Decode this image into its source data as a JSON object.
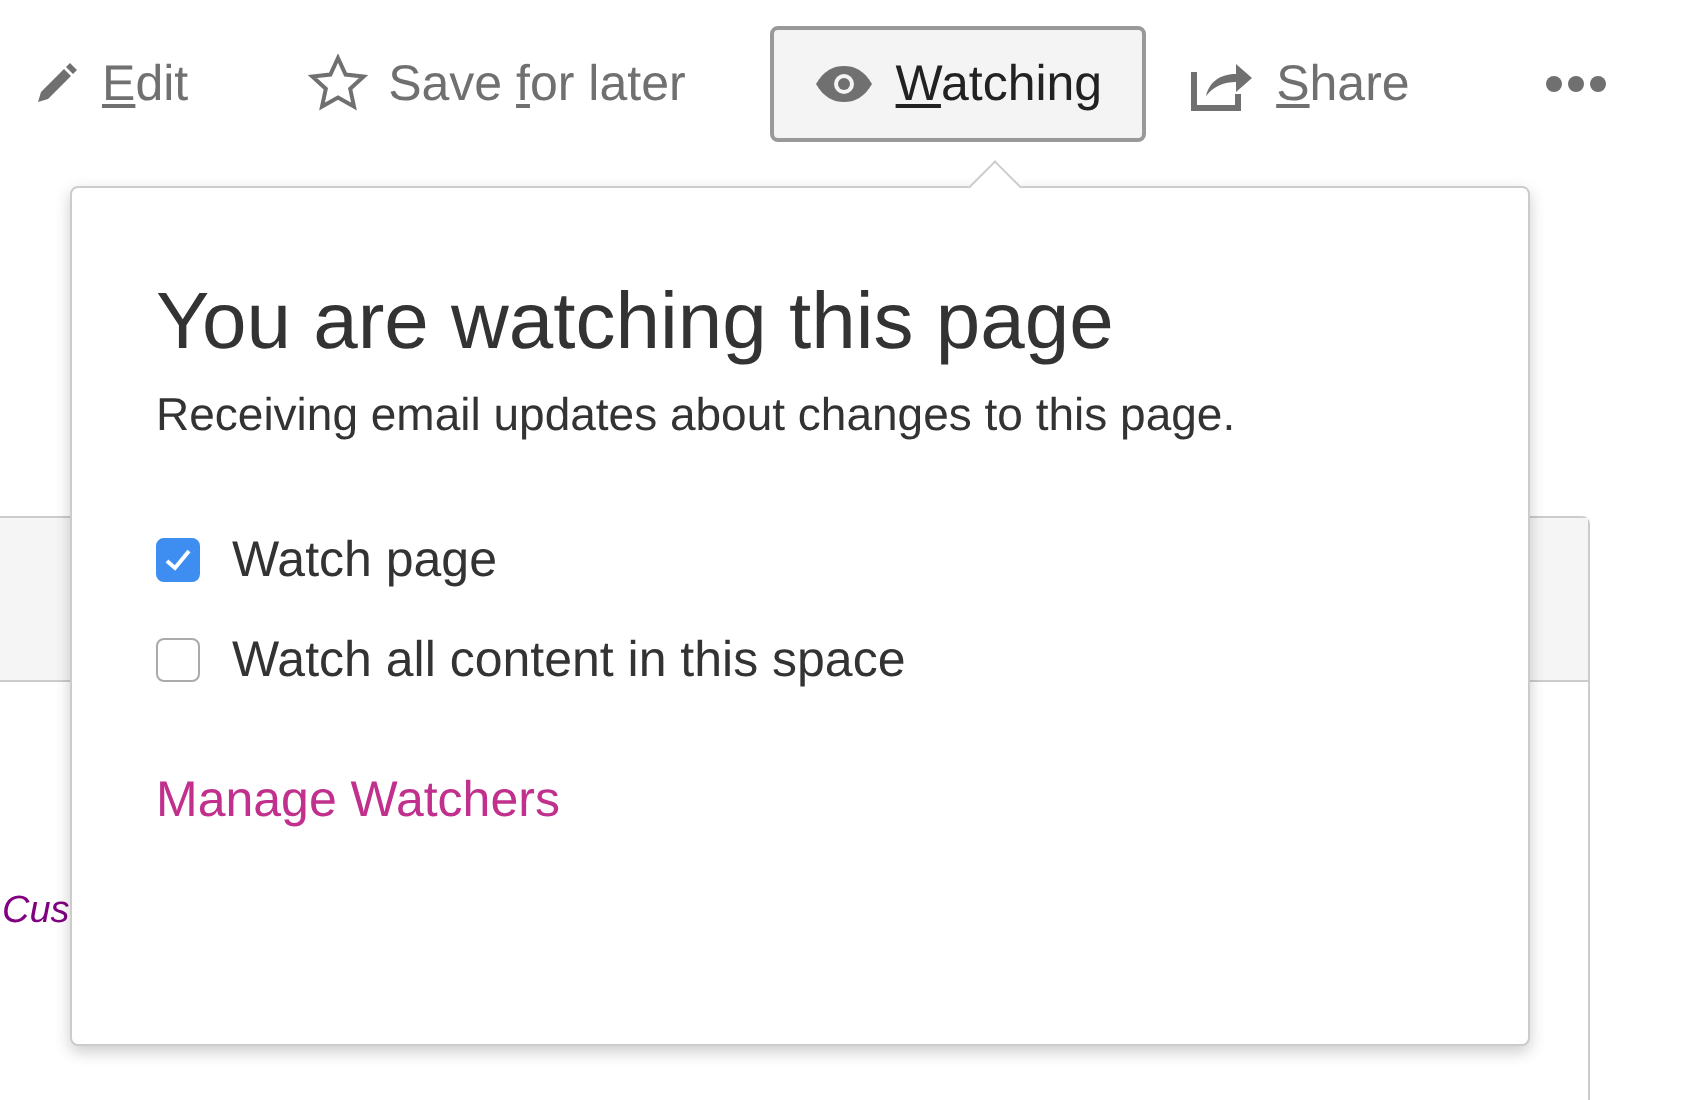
{
  "toolbar": [
    {
      "kind": "edit",
      "key": "E",
      "after": "dit",
      "selected": false
    },
    {
      "kind": "star",
      "before": "Save ",
      "key": "f",
      "after": "or later",
      "selected": false
    },
    {
      "kind": "eye",
      "key": "W",
      "after": "atching",
      "selected": true
    },
    {
      "kind": "share",
      "key": "S",
      "after": "hare",
      "selected": false
    },
    {
      "kind": "more",
      "selected": false
    }
  ],
  "background": {
    "link_fragment": "Cus"
  },
  "popover": {
    "title": "You are watching this page",
    "description": "Receiving email updates about changes to this page.",
    "options": [
      {
        "label": "Watch page",
        "checked": true
      },
      {
        "label": "Watch all content in this space",
        "checked": false
      }
    ],
    "link": "Manage Watchers"
  }
}
